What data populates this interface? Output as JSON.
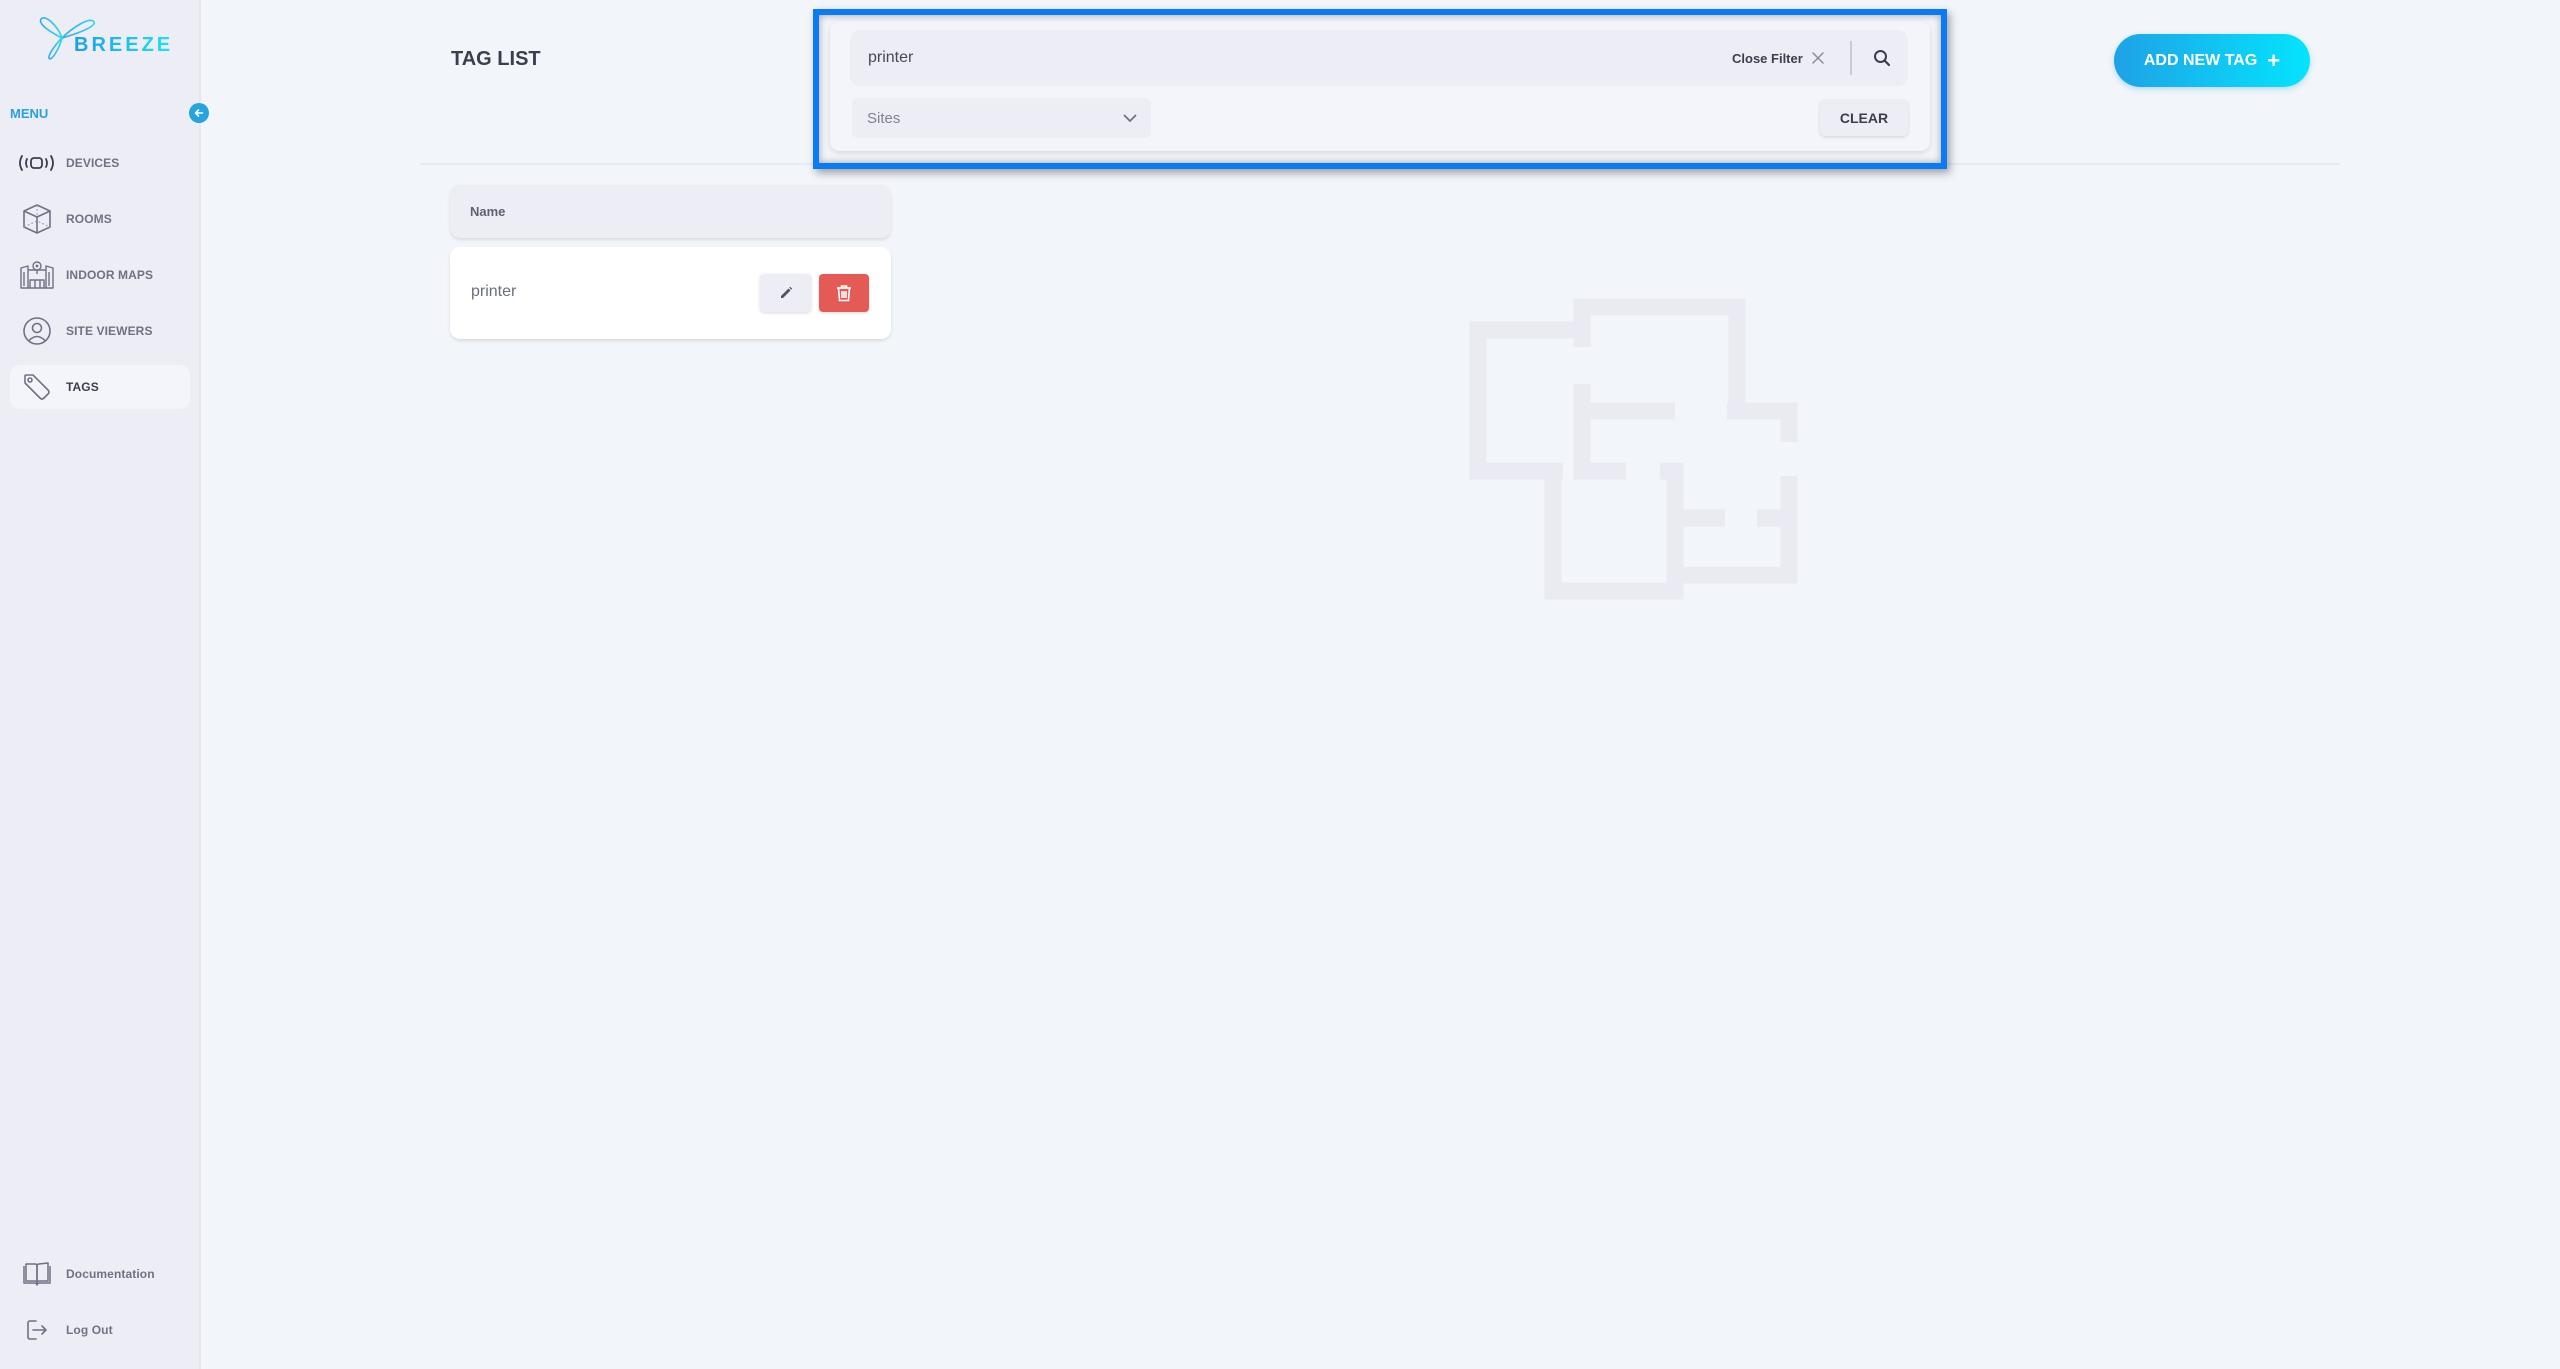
{
  "app": {
    "brand_name": "BREEZE",
    "accent_color": "#26a4e0",
    "danger_color": "#e45b55"
  },
  "sidebar": {
    "menu_label": "MENU",
    "collapse_icon": "arrow-left-icon",
    "items": [
      {
        "label": "DEVICES",
        "icon": "devices-icon",
        "active": false
      },
      {
        "label": "ROOMS",
        "icon": "cube-icon",
        "active": false
      },
      {
        "label": "INDOOR MAPS",
        "icon": "indoor-map-icon",
        "active": false
      },
      {
        "label": "SITE VIEWERS",
        "icon": "user-circle-icon",
        "active": false
      },
      {
        "label": "TAGS",
        "icon": "tag-icon",
        "active": true
      }
    ],
    "bottom_items": [
      {
        "label": "Documentation",
        "icon": "book-icon"
      },
      {
        "label": "Log Out",
        "icon": "logout-icon"
      }
    ]
  },
  "header": {
    "title": "TAG LIST",
    "add_button_label": "ADD NEW TAG",
    "add_button_icon": "+"
  },
  "filter": {
    "search_value": "printer",
    "close_filter_label": "Close Filter",
    "sites_placeholder": "Sites",
    "clear_label": "CLEAR"
  },
  "table": {
    "columns": [
      "Name"
    ],
    "rows": [
      {
        "name": "printer"
      }
    ]
  }
}
